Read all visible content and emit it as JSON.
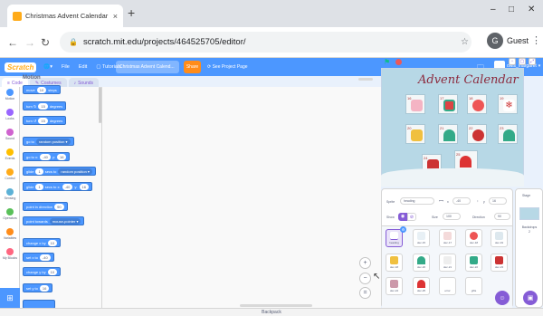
{
  "browser": {
    "tab_title": "Christmas Advent Calendar - Inv",
    "tab_close": "×",
    "new_tab": "+",
    "url": "scratch.mit.edu/projects/464525705/editor/",
    "profile": "Guest",
    "profile_initial": "G",
    "window_min": "–",
    "window_max": "□",
    "window_close": "✕"
  },
  "menubar": {
    "logo": "Scratch",
    "file": "File",
    "edit": "Edit",
    "tutorials": "Tutorials",
    "project_title": "Christmas Advent Calend...",
    "share": "Share",
    "see_project": "See Project Page",
    "username": "owls_margaret"
  },
  "editor_tabs": [
    "Code",
    "Costumes",
    "Sounds"
  ],
  "categories": [
    {
      "name": "Motion",
      "color": "#4c97ff"
    },
    {
      "name": "Looks",
      "color": "#9966ff"
    },
    {
      "name": "Sound",
      "color": "#cf63cf"
    },
    {
      "name": "Events",
      "color": "#ffbf00"
    },
    {
      "name": "Control",
      "color": "#ffab19"
    },
    {
      "name": "Sensing",
      "color": "#5cb1d6"
    },
    {
      "name": "Operators",
      "color": "#59c059"
    },
    {
      "name": "Variables",
      "color": "#ff8c1a"
    },
    {
      "name": "My Blocks",
      "color": "#ff6680"
    }
  ],
  "palette": {
    "section": "Motion",
    "blocks": [
      {
        "pre": "move",
        "val": "10",
        "post": "steps"
      },
      {
        "pre": "turn ↻",
        "val": "15",
        "post": "degrees"
      },
      {
        "pre": "turn ↺",
        "val": "15",
        "post": "degrees"
      },
      {
        "pre": "go to",
        "dd": "random position ▾"
      },
      {
        "pre": "go to x:",
        "val": "-40",
        "mid": "y:",
        "val2": "16"
      },
      {
        "pre": "glide",
        "val": "1",
        "mid": "secs to",
        "dd": "random position ▾"
      },
      {
        "pre": "glide",
        "val": "1",
        "mid": "secs to x:",
        "val2": "-40",
        "mid2": "y:",
        "val3": "16"
      },
      {
        "pre": "point in direction",
        "val": "90"
      },
      {
        "pre": "point towards",
        "dd": "mouse-pointer ▾"
      },
      {
        "pre": "change x by",
        "val": "10"
      },
      {
        "pre": "set x to",
        "val": "-40"
      },
      {
        "pre": "change y by",
        "val": "10"
      },
      {
        "pre": "set y to",
        "val": "16"
      }
    ]
  },
  "zoom": {
    "in": "+",
    "out": "−",
    "reset": "="
  },
  "backpack": "Backpack",
  "stage": {
    "title": "Advent Calendar",
    "doors": [
      "16",
      "17",
      "18",
      "19",
      "20",
      "21",
      "22",
      "23",
      "24",
      "25"
    ]
  },
  "sprite_info": {
    "sprite_label": "Sprite",
    "sprite_name": "heading",
    "x_label": "x",
    "x_val": "-40",
    "y_label": "y",
    "y_val": "16",
    "show_label": "Show",
    "size_label": "Size",
    "size_val": "100",
    "direction_label": "Direction",
    "direction_val": "90"
  },
  "sprites": [
    "heading",
    "dec-15",
    "dec-17",
    "dec-18",
    "dec-19",
    "dec-18",
    "dec-20",
    "dec-21",
    "dec-22",
    "dec-23",
    "dec-24",
    "dec-25",
    "error",
    "gifts"
  ],
  "stage_panel": {
    "title": "Stage",
    "backdrops_label": "Backdrops",
    "backdrops_count": "2"
  }
}
